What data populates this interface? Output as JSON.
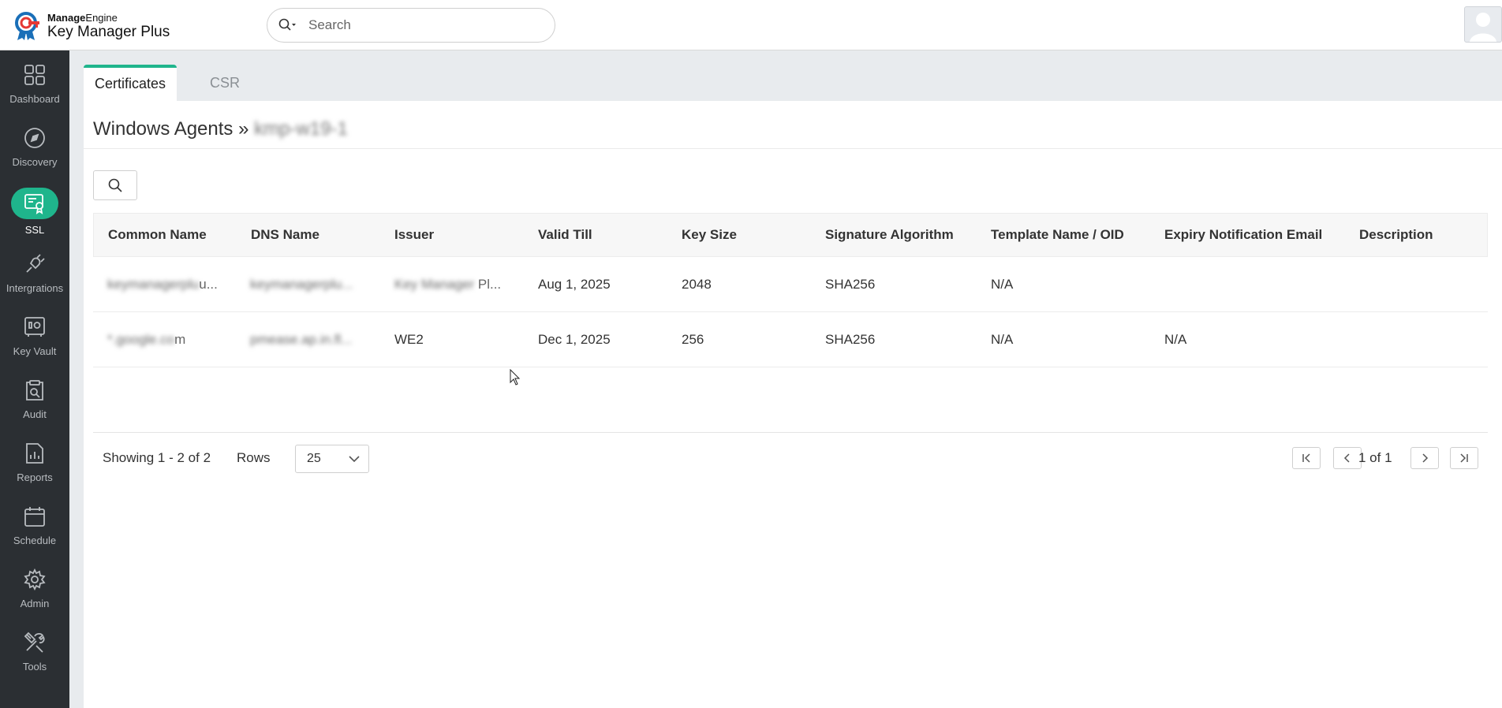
{
  "header": {
    "brand_bold": "Manage",
    "brand_rest": "Engine",
    "product": "Key Manager Plus",
    "search_placeholder": "Search"
  },
  "sidebar": {
    "items": [
      {
        "label": "Dashboard",
        "icon": "dashboard-icon",
        "active": false
      },
      {
        "label": "Discovery",
        "icon": "compass-icon",
        "active": false
      },
      {
        "label": "SSL",
        "icon": "certificate-icon",
        "active": true
      },
      {
        "label": "Intergrations",
        "icon": "plug-icon",
        "active": false
      },
      {
        "label": "Key Vault",
        "icon": "vault-icon",
        "active": false
      },
      {
        "label": "Audit",
        "icon": "audit-icon",
        "active": false
      },
      {
        "label": "Reports",
        "icon": "reports-icon",
        "active": false
      },
      {
        "label": "Schedule",
        "icon": "calendar-icon",
        "active": false
      },
      {
        "label": "Admin",
        "icon": "gear-icon",
        "active": false
      },
      {
        "label": "Tools",
        "icon": "tools-icon",
        "active": false
      }
    ]
  },
  "tabs": {
    "certificates": "Certificates",
    "csr": "CSR"
  },
  "breadcrumb": {
    "parent": "Windows Agents »",
    "current": "kmp-w19-1"
  },
  "table": {
    "columns": [
      "Common Name",
      "DNS Name",
      "Issuer",
      "Valid Till",
      "Key Size",
      "Signature Algorithm",
      "Template Name / OID",
      "Expiry Notification Email",
      "Description"
    ],
    "rows": [
      {
        "common_name": "keymanagerplu",
        "common_name_suffix": "u...",
        "dns_name": "keymanagerplu...",
        "issuer_blur": "Key Manager",
        "issuer_tail": "Pl...",
        "valid_till": "Aug 1, 2025",
        "key_size": "2048",
        "signature_algorithm": "SHA256",
        "template": "N/A",
        "expiry_email": "",
        "description": ""
      },
      {
        "common_name": "*.google.co",
        "common_name_suffix": "m",
        "dns_name": "pmease.ap.in.fl...",
        "issuer": "WE2",
        "valid_till": "Dec 1, 2025",
        "key_size": "256",
        "signature_algorithm": "SHA256",
        "template": "N/A",
        "expiry_email": "N/A",
        "description": ""
      }
    ]
  },
  "pagination": {
    "showing": "Showing 1 - 2 of 2",
    "rows_label": "Rows",
    "rows_value": "25",
    "page_info": "1 of 1"
  },
  "colors": {
    "accent": "#1fb58c",
    "sidebar_bg": "#2b2f33"
  }
}
